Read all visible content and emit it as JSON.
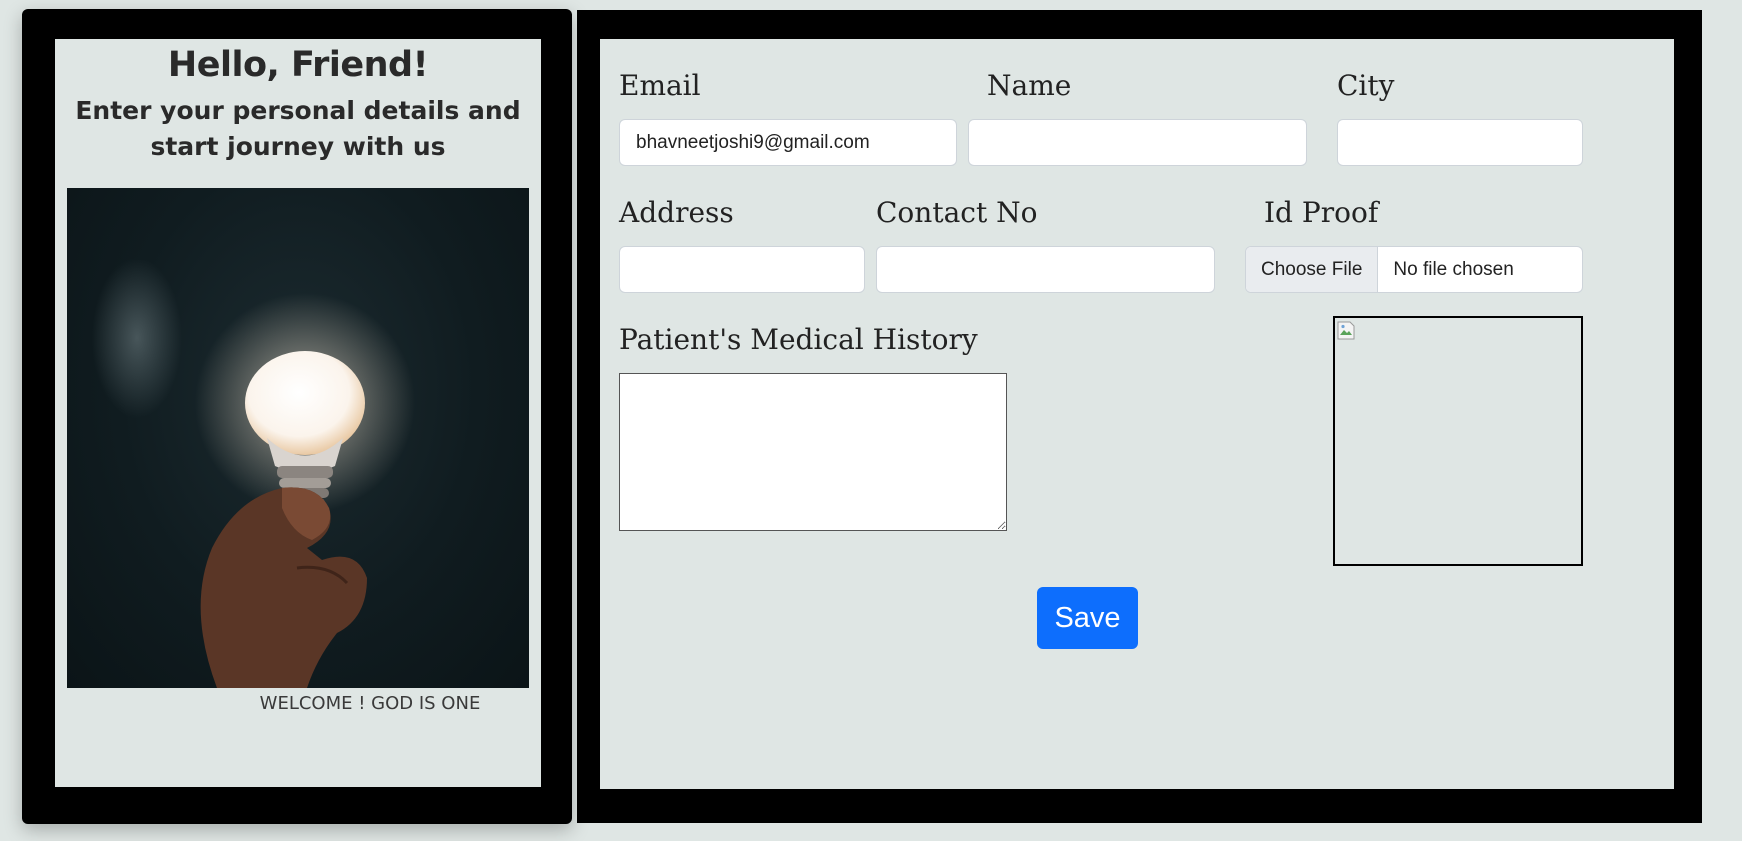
{
  "welcome_panel": {
    "heading": "Hello, Friend!",
    "subtitle": "Enter your personal details and start journey with us",
    "image": "hand-holding-light-bulb",
    "footer": "WELCOME ! GOD IS ONE"
  },
  "form": {
    "email": {
      "label": "Email",
      "value": "bhavneetjoshi9@gmail.com"
    },
    "name": {
      "label": "Name",
      "value": ""
    },
    "city": {
      "label": "City",
      "value": ""
    },
    "address": {
      "label": "Address",
      "value": ""
    },
    "contact": {
      "label": "Contact No",
      "value": ""
    },
    "id_proof": {
      "label": "Id Proof",
      "button": "Choose File",
      "status": "No file chosen"
    },
    "medical_history": {
      "label": "Patient's Medical History",
      "value": ""
    },
    "preview_icon": "broken-image-icon",
    "save_label": "Save"
  },
  "colors": {
    "background": "#dfe6e4",
    "frame": "#000000",
    "primary": "#0d6efd"
  }
}
